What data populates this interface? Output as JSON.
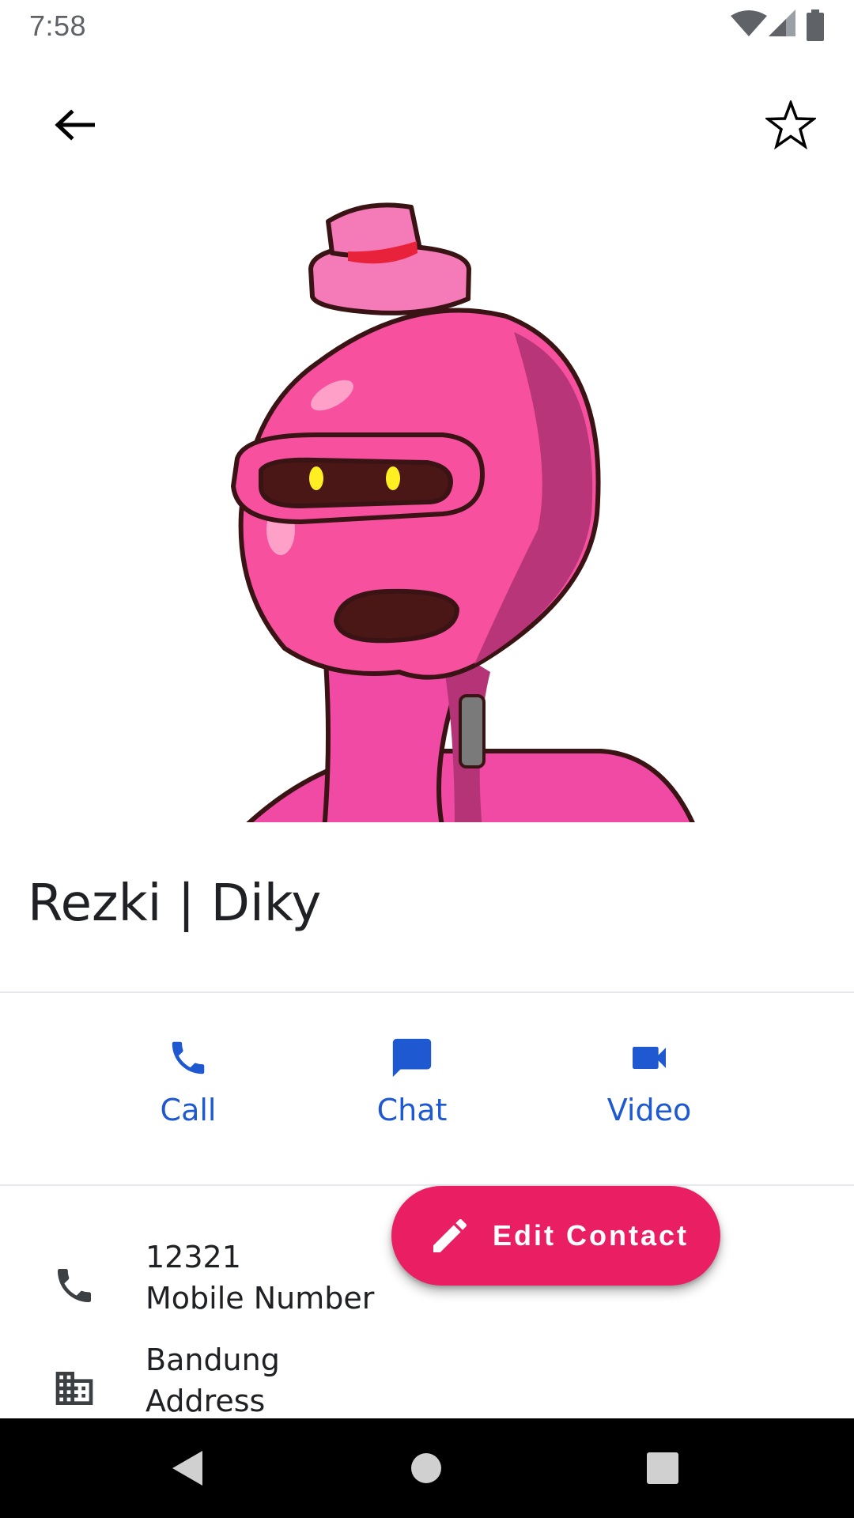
{
  "status_bar": {
    "time": "7:58",
    "icons": [
      "wifi-icon",
      "cell-signal-icon",
      "battery-icon"
    ]
  },
  "app_bar": {
    "back_icon": "arrow-back-icon",
    "favorite_icon": "star-outline-icon"
  },
  "contact": {
    "name": "Rezki | Diky",
    "photo": "contact-avatar-pink-robot"
  },
  "actions": [
    {
      "label": "Call",
      "icon": "phone-icon"
    },
    {
      "label": "Chat",
      "icon": "chat-bubble-icon"
    },
    {
      "label": "Video",
      "icon": "videocam-icon"
    }
  ],
  "details": [
    {
      "value": "12321",
      "type": "Mobile Number",
      "icon": "phone-icon"
    },
    {
      "value": "Bandung",
      "type": "Address",
      "icon": "business-icon"
    }
  ],
  "fab": {
    "label": "Edit Contact",
    "icon": "edit-pencil-icon"
  },
  "nav_bar": {
    "buttons": [
      "nav-back-icon",
      "nav-home-icon",
      "nav-recents-icon"
    ]
  },
  "colors": {
    "accent_blue": "#1e59d1",
    "fab_pink": "#e91e63",
    "text_dark": "#202124",
    "status_gray": "#5f6368"
  }
}
